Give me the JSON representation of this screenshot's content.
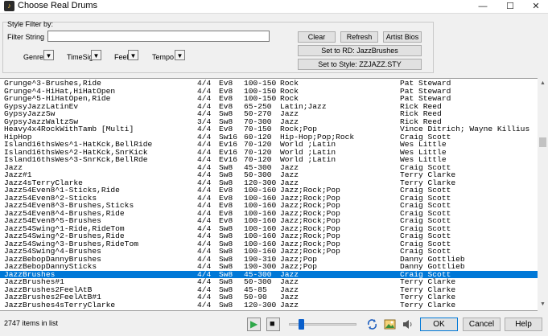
{
  "window": {
    "title": "Choose Real Drums",
    "minimize_glyph": "—",
    "maximize_glyph": "☐",
    "close_glyph": "✕"
  },
  "filter": {
    "group_label": "Style Filter by:",
    "string_label": "Filter String",
    "string_value": "",
    "genre_label": "Genre",
    "timesig_label": "TimeSig",
    "feel_label": "Feel",
    "tempo_label": "Tempo"
  },
  "buttons": {
    "clear": "Clear",
    "refresh": "Refresh",
    "artist_bios": "Artist Bios",
    "set_rd": "Set to RD: JazzBrushes",
    "set_style": "Set to Style: ZZJAZZ.STY"
  },
  "list": {
    "selected_index": 25,
    "rows": [
      [
        "Grunge^3-Brushes,Ride",
        "4/4",
        "Ev8",
        "100-150",
        "Rock",
        "Pat Steward"
      ],
      [
        "Grunge^4-HiHat,HiHatOpen",
        "4/4",
        "Ev8",
        "100-150",
        "Rock",
        "Pat Steward"
      ],
      [
        "Grunge^5-HiHatOpen,Ride",
        "4/4",
        "Ev8",
        "100-150",
        "Rock",
        "Pat Steward"
      ],
      [
        "GypsyJazzLatinEv",
        "4/4",
        "Ev8",
        "65-250",
        "Latin;Jazz",
        "Rick Reed"
      ],
      [
        "GypsyJazzSw",
        "4/4",
        "Sw8",
        "50-270",
        "Jazz",
        "Rick Reed"
      ],
      [
        "GypsyJazzWaltzSw",
        "3/4",
        "Sw8",
        "70-300",
        "Jazz",
        "Rick Reed"
      ],
      [
        "Heavy4x4RockWithTamb [Multi]",
        "4/4",
        "Ev8",
        "70-150",
        "Rock;Pop",
        "Vince Ditrich; Wayne Killius"
      ],
      [
        "HipHop",
        "4/4",
        "Sw16",
        "60-120",
        "Hip-Hop;Pop;Rock",
        "Craig Scott"
      ],
      [
        "Island16thsWes^1-HatKck,BellRide",
        "4/4",
        "Ev16",
        "70-120",
        "World ;Latin",
        "Wes Little"
      ],
      [
        "Island16thsWes^2-HatKck,SnrKick",
        "4/4",
        "Ev16",
        "70-120",
        "World ;Latin",
        "Wes Little"
      ],
      [
        "Island16thsWes^3-SnrKck,BellRde",
        "4/4",
        "Ev16",
        "70-120",
        "World ;Latin",
        "Wes Little"
      ],
      [
        "Jazz",
        "4/4",
        "Sw8",
        "45-300",
        "Jazz",
        "Craig Scott"
      ],
      [
        "Jazz#1",
        "4/4",
        "Sw8",
        "50-300",
        "Jazz",
        "Terry Clarke"
      ],
      [
        "Jazz4sTerryClarke",
        "4/4",
        "Sw8",
        "120-300",
        "Jazz",
        "Terry Clarke"
      ],
      [
        "Jazz54Even8^1-Sticks,Ride",
        "4/4",
        "Ev8",
        "100-160",
        "Jazz;Rock;Pop",
        "Craig Scott"
      ],
      [
        "Jazz54Even8^2-Sticks",
        "4/4",
        "Ev8",
        "100-160",
        "Jazz;Rock;Pop",
        "Craig Scott"
      ],
      [
        "Jazz54Even8^3-Brushes,Sticks",
        "4/4",
        "Ev8",
        "100-160",
        "Jazz;Rock;Pop",
        "Craig Scott"
      ],
      [
        "Jazz54Even8^4-Brushes,Ride",
        "4/4",
        "Ev8",
        "100-160",
        "Jazz;Rock;Pop",
        "Craig Scott"
      ],
      [
        "Jazz54Even8^5-Brushes",
        "4/4",
        "Ev8",
        "100-160",
        "Jazz;Rock;Pop",
        "Craig Scott"
      ],
      [
        "Jazz54Swing^1-Ride,RideTom",
        "4/4",
        "Sw8",
        "100-160",
        "Jazz;Rock;Pop",
        "Craig Scott"
      ],
      [
        "Jazz54Swing^2-Brushes,Ride",
        "4/4",
        "Sw8",
        "100-160",
        "Jazz;Rock;Pop",
        "Craig Scott"
      ],
      [
        "Jazz54Swing^3-Brushes,RideTom",
        "4/4",
        "Sw8",
        "100-160",
        "Jazz;Rock;Pop",
        "Craig Scott"
      ],
      [
        "Jazz54Swing^4-Brushes",
        "4/4",
        "Sw8",
        "100-160",
        "Jazz;Rock;Pop",
        "Craig Scott"
      ],
      [
        "JazzBebopDannyBrushes",
        "4/4",
        "Sw8",
        "190-310",
        "Jazz;Pop",
        "Danny Gottlieb"
      ],
      [
        "JazzBebopDannySticks",
        "4/4",
        "Sw8",
        "190-300",
        "Jazz;Pop",
        "Danny Gottlieb"
      ],
      [
        "JazzBrushes",
        "4/4",
        "Sw8",
        "45-300",
        "Jazz",
        "Craig Scott"
      ],
      [
        "JazzBrushes#1",
        "4/4",
        "Sw8",
        "50-300",
        "Jazz",
        "Terry Clarke"
      ],
      [
        "JazzBrushes2FeelAtB",
        "4/4",
        "Sw8",
        "45-85",
        "Jazz",
        "Terry Clarke"
      ],
      [
        "JazzBrushes2FeelAtB#1",
        "4/4",
        "Sw8",
        "50-90",
        "Jazz",
        "Terry Clarke"
      ],
      [
        "JazzBrushes4sTerryClarke",
        "4/4",
        "Sw8",
        "120-300",
        "Jazz",
        "Terry Clarke"
      ]
    ]
  },
  "scrollbar": {
    "up_glyph": "▲",
    "down_glyph": "▼"
  },
  "footer": {
    "status": "2747 items in list",
    "play_glyph": "▶",
    "stop_glyph": "■",
    "ok": "OK",
    "cancel": "Cancel",
    "help": "Help"
  },
  "colors": {
    "selection": "#0078d7",
    "play_green": "#2ea84a",
    "slider_blue": "#0a5fcb"
  }
}
